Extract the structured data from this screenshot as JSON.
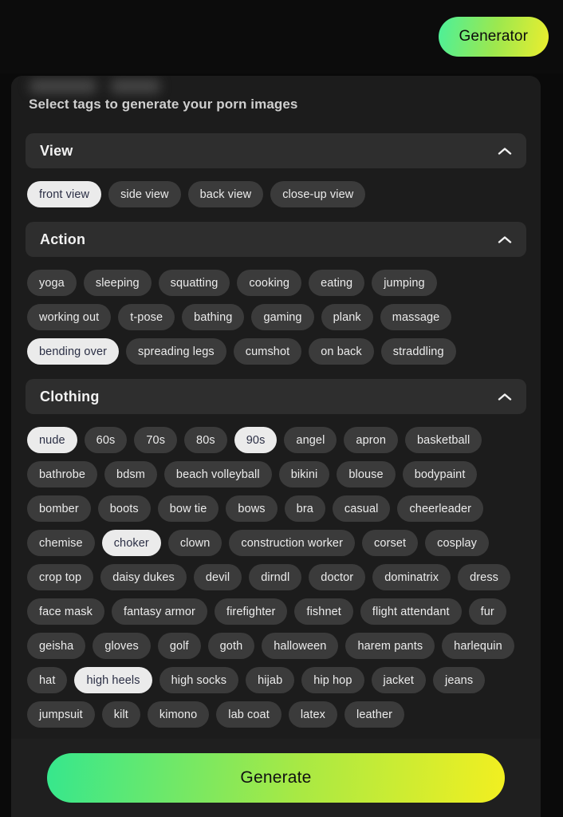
{
  "topbar": {
    "generator_label": "Generator"
  },
  "panel": {
    "title": "Select tags to generate your porn images"
  },
  "colors": {
    "page_background": "#0a0a0a",
    "panel_background": "#1c1c1c",
    "section_header": "#2e2e2e",
    "tag_unselected": "#3b3b3b",
    "tag_selected": "#ebebeb",
    "tag_selected_text": "#2b2f45",
    "accent_gradient_start": "#36e78d",
    "accent_gradient_mid": "#a8e944",
    "accent_gradient_end": "#f2ef20"
  },
  "icons": {
    "collapse": "chevron-up-icon"
  },
  "sections": [
    {
      "id": "view",
      "title": "View",
      "expanded": true,
      "tags": [
        {
          "label": "front view",
          "selected": true
        },
        {
          "label": "side view",
          "selected": false
        },
        {
          "label": "back view",
          "selected": false
        },
        {
          "label": "close-up view",
          "selected": false
        }
      ]
    },
    {
      "id": "action",
      "title": "Action",
      "expanded": true,
      "tags": [
        {
          "label": "yoga",
          "selected": false
        },
        {
          "label": "sleeping",
          "selected": false
        },
        {
          "label": "squatting",
          "selected": false
        },
        {
          "label": "cooking",
          "selected": false
        },
        {
          "label": "eating",
          "selected": false
        },
        {
          "label": "jumping",
          "selected": false
        },
        {
          "label": "working out",
          "selected": false
        },
        {
          "label": "t-pose",
          "selected": false
        },
        {
          "label": "bathing",
          "selected": false
        },
        {
          "label": "gaming",
          "selected": false
        },
        {
          "label": "plank",
          "selected": false
        },
        {
          "label": "massage",
          "selected": false
        },
        {
          "label": "bending over",
          "selected": true
        },
        {
          "label": "spreading legs",
          "selected": false
        },
        {
          "label": "cumshot",
          "selected": false
        },
        {
          "label": "on back",
          "selected": false
        },
        {
          "label": "straddling",
          "selected": false
        }
      ]
    },
    {
      "id": "clothing",
      "title": "Clothing",
      "expanded": true,
      "tags": [
        {
          "label": "nude",
          "selected": true
        },
        {
          "label": "60s",
          "selected": false
        },
        {
          "label": "70s",
          "selected": false
        },
        {
          "label": "80s",
          "selected": false
        },
        {
          "label": "90s",
          "selected": true
        },
        {
          "label": "angel",
          "selected": false
        },
        {
          "label": "apron",
          "selected": false
        },
        {
          "label": "basketball",
          "selected": false
        },
        {
          "label": "bathrobe",
          "selected": false
        },
        {
          "label": "bdsm",
          "selected": false
        },
        {
          "label": "beach volleyball",
          "selected": false
        },
        {
          "label": "bikini",
          "selected": false
        },
        {
          "label": "blouse",
          "selected": false
        },
        {
          "label": "bodypaint",
          "selected": false
        },
        {
          "label": "bomber",
          "selected": false
        },
        {
          "label": "boots",
          "selected": false
        },
        {
          "label": "bow tie",
          "selected": false
        },
        {
          "label": "bows",
          "selected": false
        },
        {
          "label": "bra",
          "selected": false
        },
        {
          "label": "casual",
          "selected": false
        },
        {
          "label": "cheerleader",
          "selected": false
        },
        {
          "label": "chemise",
          "selected": false
        },
        {
          "label": "choker",
          "selected": true
        },
        {
          "label": "clown",
          "selected": false
        },
        {
          "label": "construction worker",
          "selected": false
        },
        {
          "label": "corset",
          "selected": false
        },
        {
          "label": "cosplay",
          "selected": false
        },
        {
          "label": "crop top",
          "selected": false
        },
        {
          "label": "daisy dukes",
          "selected": false
        },
        {
          "label": "devil",
          "selected": false
        },
        {
          "label": "dirndl",
          "selected": false
        },
        {
          "label": "doctor",
          "selected": false
        },
        {
          "label": "dominatrix",
          "selected": false
        },
        {
          "label": "dress",
          "selected": false
        },
        {
          "label": "face mask",
          "selected": false
        },
        {
          "label": "fantasy armor",
          "selected": false
        },
        {
          "label": "firefighter",
          "selected": false
        },
        {
          "label": "fishnet",
          "selected": false
        },
        {
          "label": "flight attendant",
          "selected": false
        },
        {
          "label": "fur",
          "selected": false
        },
        {
          "label": "geisha",
          "selected": false
        },
        {
          "label": "gloves",
          "selected": false
        },
        {
          "label": "golf",
          "selected": false
        },
        {
          "label": "goth",
          "selected": false
        },
        {
          "label": "halloween",
          "selected": false
        },
        {
          "label": "harem pants",
          "selected": false
        },
        {
          "label": "harlequin",
          "selected": false
        },
        {
          "label": "hat",
          "selected": false
        },
        {
          "label": "high heels",
          "selected": true
        },
        {
          "label": "high socks",
          "selected": false
        },
        {
          "label": "hijab",
          "selected": false
        },
        {
          "label": "hip hop",
          "selected": false
        },
        {
          "label": "jacket",
          "selected": false
        },
        {
          "label": "jeans",
          "selected": false
        },
        {
          "label": "jumpsuit",
          "selected": false
        },
        {
          "label": "kilt",
          "selected": false
        },
        {
          "label": "kimono",
          "selected": false
        },
        {
          "label": "lab coat",
          "selected": false
        },
        {
          "label": "latex",
          "selected": false
        },
        {
          "label": "leather",
          "selected": false
        }
      ]
    }
  ],
  "bottom_bar": {
    "generate_label": "Generate"
  }
}
